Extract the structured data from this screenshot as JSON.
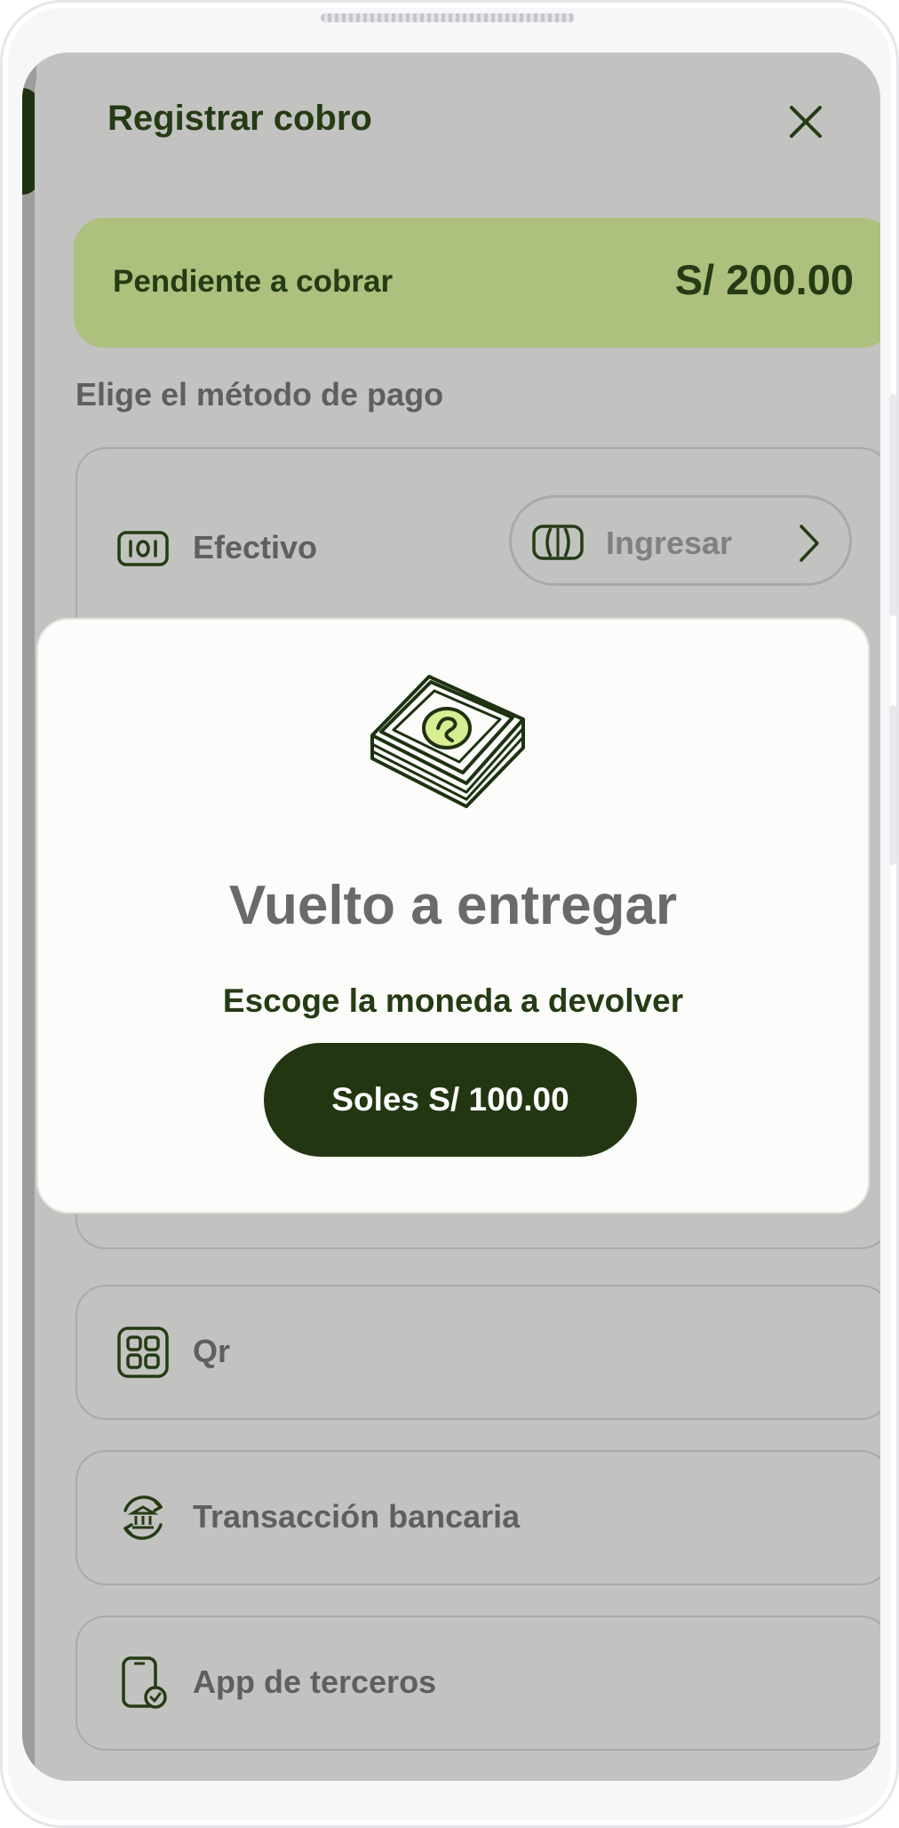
{
  "header": {
    "title": "Registrar cobro"
  },
  "pending": {
    "label": "Pendiente a cobrar",
    "amount": "S/ 200.00"
  },
  "methods_label": "Elige el método de pago",
  "methods": {
    "cash": {
      "label": "Efectivo",
      "action_label": "Ingresar"
    },
    "qr": {
      "label": "Qr"
    },
    "bank": {
      "label": "Transacción bancaria"
    },
    "third_app": {
      "label": "App de terceros"
    }
  },
  "modal": {
    "title": "Vuelto a entregar",
    "subtitle": "Escoge la moneda  a devolver",
    "button_label": "Soles S/ 100.00"
  },
  "colors": {
    "brand_dark": "#223711",
    "accent_green": "#adc07e",
    "overlay": "#c2c2c0"
  },
  "icons": [
    "close-icon",
    "cash-bill-icon",
    "banknote-icon",
    "chevron-right-icon",
    "qr-grid-icon",
    "bank-transfer-icon",
    "phone-check-icon",
    "money-stack-illustration"
  ]
}
